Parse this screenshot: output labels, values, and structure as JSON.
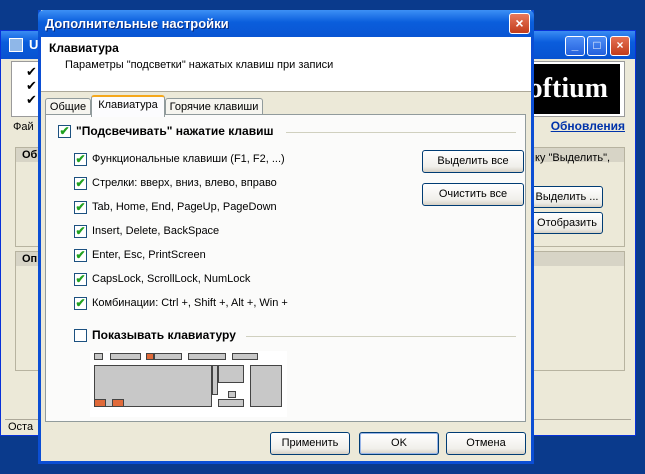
{
  "background_window": {
    "title": "U",
    "logo_text": "oftium",
    "menu_file": "Фай",
    "updates_link": "Обновления",
    "group1_title": "Об",
    "group2_title": "Оп",
    "hint_text": "ку \"Выделить\",",
    "select_button": "Выделить ...",
    "display_button": "Отобразить",
    "status_text": "Оста",
    "minimize_glyph": "_",
    "maximize_glyph": "□",
    "close_glyph": "×"
  },
  "dialog": {
    "title": "Дополнительные настройки",
    "close_glyph": "×",
    "header_title": "Клавиатура",
    "header_subtitle": "Параметры \"подсветки\" нажатых клавиш при записи",
    "tabs": [
      {
        "label": "Общие"
      },
      {
        "label": "Клавиатура"
      },
      {
        "label": "Горячие клавиши"
      }
    ],
    "highlight_group": {
      "label": "\"Подсвечивать\" нажатие клавиш",
      "checked": true
    },
    "options": [
      {
        "label": "Функциональные клавиши (F1, F2, ...)",
        "checked": true
      },
      {
        "label": "Стрелки: вверх, вниз, влево, вправо",
        "checked": true
      },
      {
        "label": "Tab, Home, End, PageUp, PageDown",
        "checked": true
      },
      {
        "label": "Insert, Delete, BackSpace",
        "checked": true
      },
      {
        "label": "Enter, Esc, PrintScreen",
        "checked": true
      },
      {
        "label": "CapsLock, ScrollLock, NumLock",
        "checked": true
      },
      {
        "label": "Комбинации: Ctrl +, Shift +, Alt +, Win +",
        "checked": true
      }
    ],
    "select_all_button": "Выделить все",
    "clear_all_button": "Очистить все",
    "show_keyboard": {
      "label": "Показывать клавиатуру",
      "checked": false
    },
    "check_glyph": "✔",
    "buttons": {
      "apply": "Применить",
      "ok": "OK",
      "cancel": "Отмена"
    },
    "colors": {
      "highlight_key": "#e06a3a",
      "title_bar": "#0a5edc",
      "check_mark": "#21a121"
    }
  }
}
